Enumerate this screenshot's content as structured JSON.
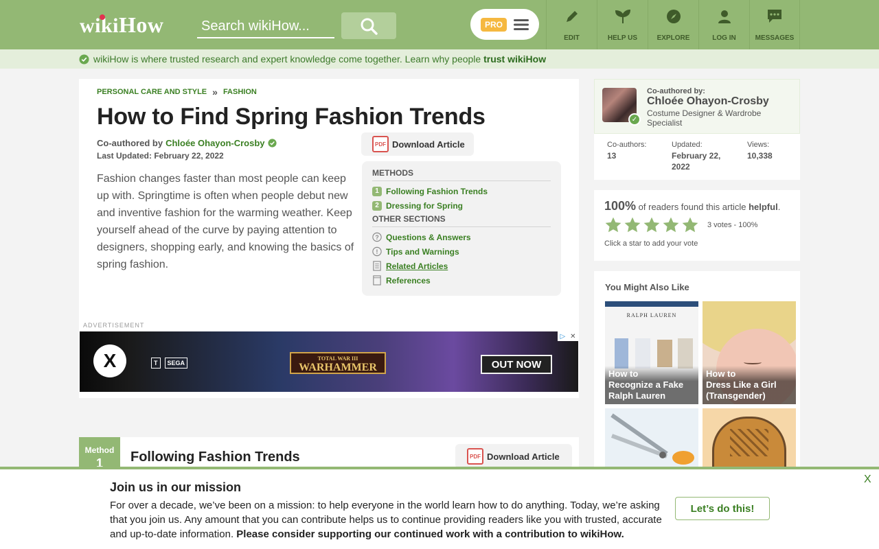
{
  "header": {
    "logo_wiki": "wiki",
    "logo_how": "How",
    "search_placeholder": "Search wikiHow...",
    "pro_label": "PRO",
    "nav": [
      {
        "label": "EDIT",
        "icon": "pencil-icon"
      },
      {
        "label": "HELP US",
        "icon": "sprout-icon"
      },
      {
        "label": "EXPLORE",
        "icon": "compass-icon"
      },
      {
        "label": "LOG IN",
        "icon": "user-icon"
      },
      {
        "label": "MESSAGES",
        "icon": "chat-bubble-icon"
      }
    ],
    "brand_color": "#93b874"
  },
  "trust_banner": {
    "text": "wikiHow is where trusted research and expert knowledge come together. Learn why people ",
    "link": "trust wikiHow"
  },
  "article": {
    "breadcrumb": [
      "PERSONAL CARE AND STYLE",
      "FASHION"
    ],
    "breadcrumb_sep": "»",
    "title": "How to Find Spring Fashion Trends",
    "byline_prefix": "Co-authored by",
    "author": "Chloée Ohayon-Crosby",
    "last_updated": "Last Updated: February 22, 2022",
    "intro": "Fashion changes faster than most people can keep up with. Springtime is often when people debut new and inventive fashion for the warming weather. Keep yourself ahead of the curve by paying attention to designers, shopping early, and knowing the basics of spring fashion.",
    "download_label": "Download Article",
    "pdf_label": "PDF",
    "toc": {
      "methods_head": "METHODS",
      "methods": [
        {
          "num": "1",
          "label": "Following Fashion Trends"
        },
        {
          "num": "2",
          "label": "Dressing for Spring"
        }
      ],
      "other_head": "OTHER SECTIONS",
      "other": [
        {
          "label": "Questions & Answers",
          "icon": "question-circle-icon"
        },
        {
          "label": "Tips and Warnings",
          "icon": "exclamation-circle-icon"
        },
        {
          "label": "Related Articles",
          "icon": "document-icon"
        },
        {
          "label": "References",
          "icon": "bookmark-icon"
        }
      ]
    },
    "ad_label": "ADVERTISEMENT",
    "ad": {
      "game_title": "WARHAMMER",
      "game_subtitle": "TOTAL WAR III",
      "cta": "OUT NOW",
      "publisher": "SEGA"
    },
    "method": {
      "tab_label": "Method",
      "tab_num": "1",
      "title": "Following Fashion Trends",
      "download_label": "Download Article"
    }
  },
  "sidebar": {
    "coauthor_label": "Co-authored by:",
    "coauthor_name": "Chloée Ohayon-Crosby",
    "coauthor_role": "Costume Designer & Wardrobe Specialist",
    "stats": [
      {
        "label": "Co-authors:",
        "value": "13"
      },
      {
        "label": "Updated:",
        "value": "February 22, 2022"
      },
      {
        "label": "Views:",
        "value": "10,338"
      }
    ],
    "helpful_pct": "100%",
    "helpful_text": " of readers found this article ",
    "helpful_word": "helpful",
    "helpful_end": ".",
    "stars_filled": 5,
    "stars_total": 5,
    "votes": "3 votes - 100%",
    "vote_hint": "Click a star to add your vote",
    "yml_head": "You Might Also Like",
    "yml": [
      {
        "caption_prefix": "How to",
        "caption": "Recognize a Fake Ralph Lauren",
        "thumb_text": "RALPH LAUREN"
      },
      {
        "caption_prefix": "How to",
        "caption": "Dress Like a Girl (Transgender)",
        "thumb_text": ""
      },
      {
        "caption_prefix": "",
        "caption": "",
        "thumb_text": ""
      },
      {
        "caption_prefix": "",
        "caption": "",
        "thumb_text": ""
      }
    ]
  },
  "mission": {
    "title": "Join us in our mission",
    "text": "For over a decade, we’ve been on a mission: to help everyone in the world learn how to do anything. Today, we’re asking that you join us. Any amount that you can contribute helps us to continue providing readers like you with trusted, accurate and up-to-date information. ",
    "text_bold": "Please consider supporting our continued work with a contribution to wikiHow.",
    "cta": "Let’s do this!",
    "close": "X"
  }
}
